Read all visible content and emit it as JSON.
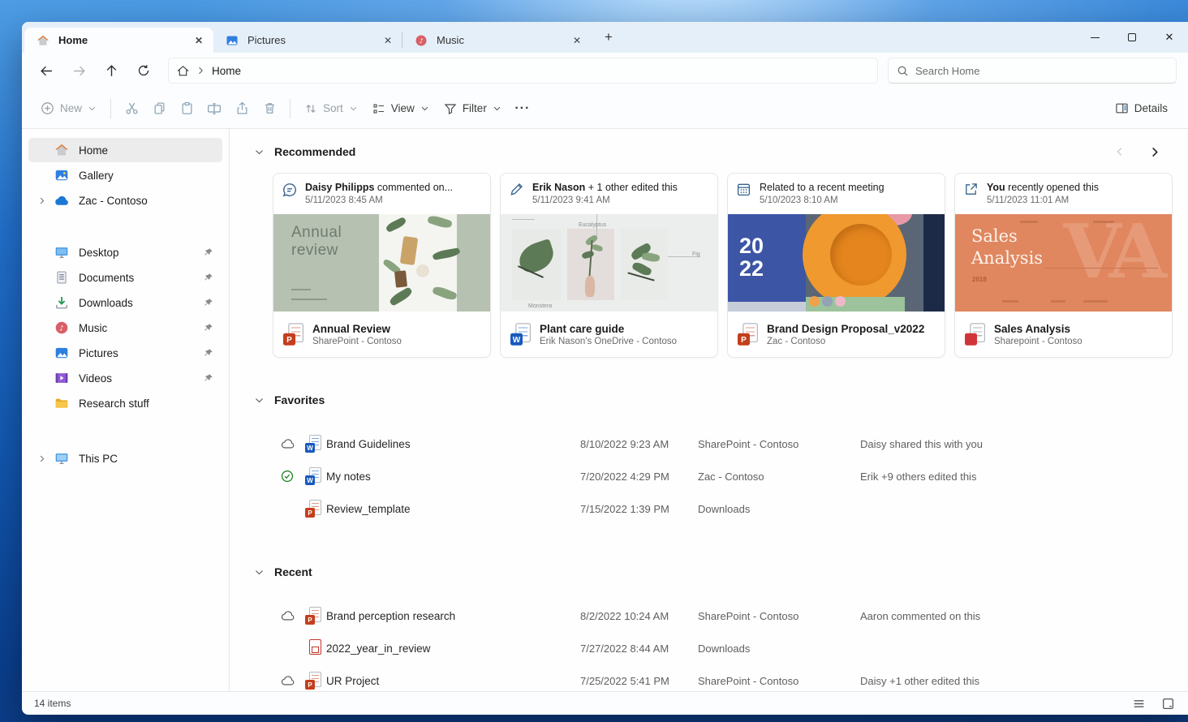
{
  "glyphs": {
    "close": "✕",
    "plus": "+",
    "ellipsis": "···",
    "music_note": "♪",
    "play": "▶"
  },
  "tabs": [
    {
      "label": "Home"
    },
    {
      "label": "Pictures"
    },
    {
      "label": "Music"
    }
  ],
  "navbar": {
    "path": "Home",
    "search_placeholder": "Search Home"
  },
  "toolbar": {
    "new": "New",
    "sort": "Sort",
    "view": "View",
    "filter": "Filter",
    "details": "Details"
  },
  "sidebar": {
    "home": "Home",
    "gallery": "Gallery",
    "onedrive": "Zac - Contoso",
    "pinned": [
      {
        "label": "Desktop"
      },
      {
        "label": "Documents"
      },
      {
        "label": "Downloads"
      },
      {
        "label": "Music"
      },
      {
        "label": "Pictures"
      },
      {
        "label": "Videos"
      }
    ],
    "folder": "Research stuff",
    "this_pc": "This PC"
  },
  "recommended": {
    "title": "Recommended",
    "cards": [
      {
        "activity_bold": "Daisy Philipps",
        "activity_rest": " commented on...",
        "date": "5/11/2023 8:45 AM",
        "file": "Annual Review",
        "location": "SharePoint - Contoso",
        "letter": "P",
        "thumb": {
          "title": "Annual review"
        }
      },
      {
        "activity_bold": "Erik Nason",
        "activity_rest": " + 1 other edited this",
        "date": "5/11/2023 9:41 AM",
        "file": "Plant care guide",
        "location": "Erik Nason's OneDrive - Contoso",
        "letter": "W",
        "thumb": {
          "labels": [
            "Eucalyptus",
            "Fig",
            "Monstera"
          ]
        }
      },
      {
        "activity_bold": "",
        "activity_rest": "Related to a recent meeting",
        "date": "5/10/2023 8:10 AM",
        "file": "Brand Design Proposal_v2022",
        "location": "Zac - Contoso",
        "letter": "P",
        "thumb": {
          "year_top": "20",
          "year_bottom": "22"
        }
      },
      {
        "activity_bold": "You",
        "activity_rest": " recently opened this",
        "date": "5/11/2023 11:01 AM",
        "file": "Sales Analysis",
        "location": "Sharepoint - Contoso",
        "letter": "",
        "thumb": {
          "title_line1": "Sales",
          "title_line2": "Analysis",
          "year": "2018",
          "watermark": "VA"
        }
      }
    ]
  },
  "favorites": {
    "title": "Favorites",
    "rows": [
      {
        "name": "Brand Guidelines",
        "date": "8/10/2022 9:23 AM",
        "location": "SharePoint - Contoso",
        "note": "Daisy shared this with you",
        "letter": "W"
      },
      {
        "name": "My notes",
        "date": "7/20/2022 4:29 PM",
        "location": "Zac - Contoso",
        "note": "Erik +9 others edited this",
        "letter": "W"
      },
      {
        "name": "Review_template",
        "date": "7/15/2022 1:39 PM",
        "location": "Downloads",
        "note": "",
        "letter": "P"
      }
    ]
  },
  "recent": {
    "title": "Recent",
    "rows": [
      {
        "name": "Brand perception research",
        "date": "8/2/2022 10:24 AM",
        "location": "SharePoint - Contoso",
        "note": "Aaron commented on this",
        "letter": "P"
      },
      {
        "name": "2022_year_in_review",
        "date": "7/27/2022 8:44 AM",
        "location": "Downloads",
        "note": "",
        "letter": ""
      },
      {
        "name": "UR Project",
        "date": "7/25/2022 5:41 PM",
        "location": "SharePoint - Contoso",
        "note": "Daisy +1 other edited this",
        "letter": "P"
      }
    ]
  },
  "statusbar": {
    "count": "14 items"
  },
  "colors": {
    "accent": "#0067c0",
    "word": "#185abd",
    "powerpoint": "#c43e1c",
    "onedrive": "#1b77d4",
    "check_green": "#0f7b0f"
  }
}
